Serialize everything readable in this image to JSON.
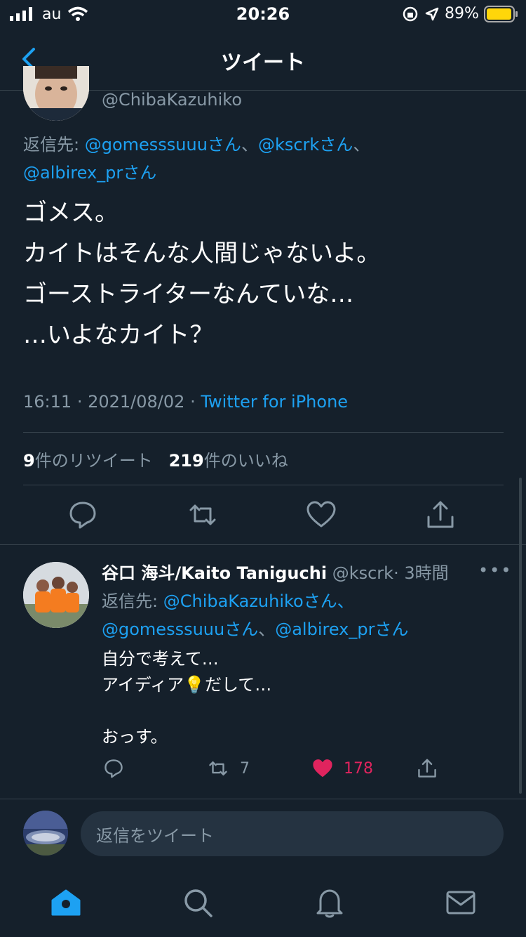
{
  "status_bar": {
    "carrier": "au",
    "time": "20:26",
    "battery_percent": "89%",
    "icons": [
      "signal-icon",
      "wifi-icon",
      "rotation-lock-icon",
      "location-icon",
      "battery-icon"
    ]
  },
  "header": {
    "back_icon": "chevron-left-icon",
    "title": "ツイート"
  },
  "main_tweet": {
    "handle": "@ChibaKazuhiko",
    "reply_prefix": "返信先: ",
    "reply_mentions": [
      "@gomesssuuuさん",
      "@kscrkさん",
      "@albirex_prさん"
    ],
    "reply_separator": "、",
    "text": "ゴメス。\nカイトはそんな人間じゃないよ。\nゴーストライターなんていな…\n…いよなカイト？",
    "time": "16:11",
    "date": "2021/08/02",
    "meta_separator": "·",
    "source": "Twitter for iPhone",
    "retweets_count": "9",
    "retweets_label": "件のリツイート",
    "likes_count": "219",
    "likes_label": "件のいいね",
    "actions": [
      "reply-icon",
      "retweet-icon",
      "like-icon",
      "share-icon"
    ]
  },
  "reply_tweet": {
    "name": "谷口 海斗/Kaito Taniguchi",
    "handle": "@kscrk",
    "time_ago": "· 3時間",
    "more": "•••",
    "reply_prefix": "返信先: ",
    "reply_mention_1": "@ChibaKazuhikoさん、",
    "reply_mention_2": "@gomesssuuuさん",
    "reply_mention_3": "@albirex_prさん",
    "reply_separator": "、",
    "text": "自分で考えて…\nアイディア💡だして…\n\nおっす。",
    "retweets": "7",
    "likes": "178",
    "liked_color": "#e0245e"
  },
  "composer": {
    "placeholder": "返信をツイート"
  },
  "tab_bar": {
    "items": [
      "home-icon",
      "search-icon",
      "notifications-icon",
      "messages-icon"
    ],
    "active": "home-icon"
  },
  "colors": {
    "background": "#15202b",
    "accent": "#1da1f2",
    "muted": "#8899a6",
    "divider": "#38444d"
  }
}
